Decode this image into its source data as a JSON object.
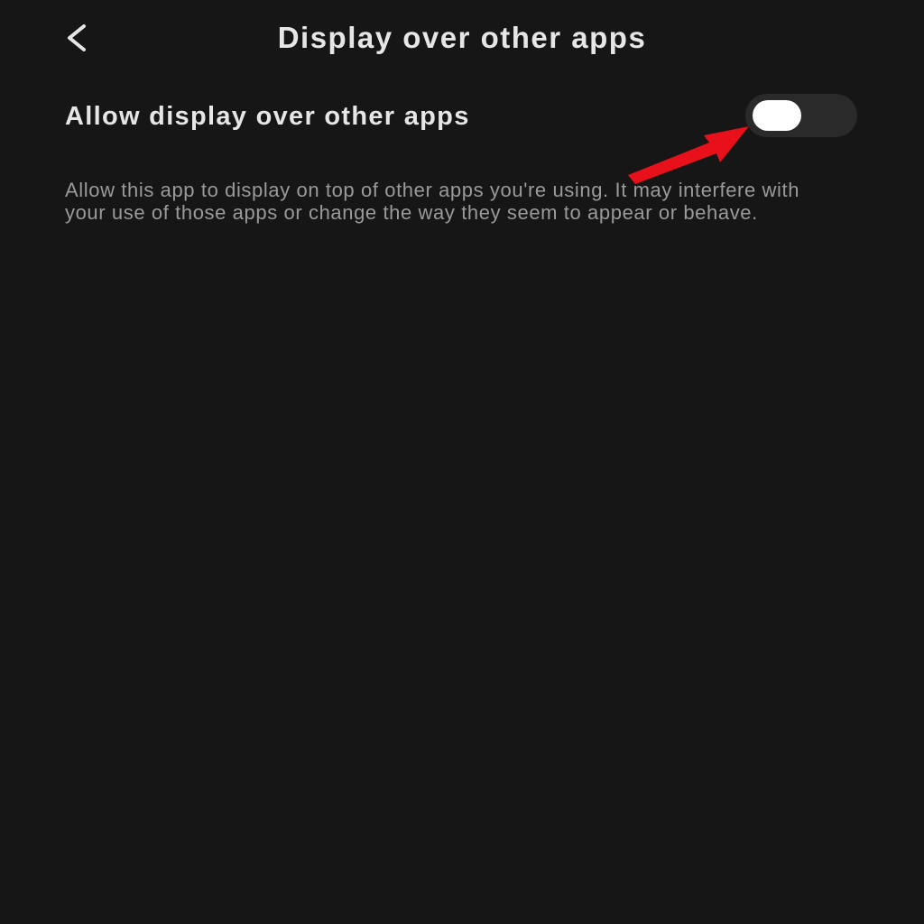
{
  "header": {
    "back_icon": "chevron-left-icon",
    "title": "Display over other apps"
  },
  "setting": {
    "label": "Allow display over other apps",
    "toggle_on": false
  },
  "description": "Allow this app to display on top of other apps you're using. It may interfere with your use of those apps or change the way they seem to appear or behave.",
  "annotation": {
    "arrow_icon": "red-arrow-icon",
    "color": "#e8101a"
  },
  "colors": {
    "background": "#161616",
    "text_primary": "#e6e6e6",
    "text_secondary": "#9a9a9a",
    "toggle_track": "#2a2a2a",
    "toggle_thumb": "#ffffff"
  }
}
